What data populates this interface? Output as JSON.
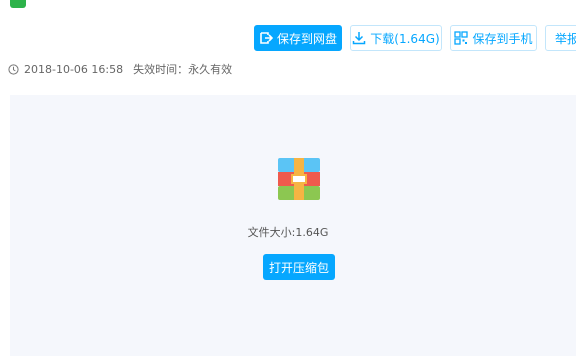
{
  "actions": {
    "save_to_cloud": "保存到网盘",
    "download": "下载(1.64G)",
    "save_to_phone": "保存到手机",
    "report": "举报"
  },
  "meta": {
    "date": "2018-10-06 16:58",
    "expire": "失效时间：永久有效"
  },
  "preview": {
    "file_size": "文件大小:1.64G",
    "open_button": "打开压缩包"
  },
  "colors": {
    "accent": "#06a7ff",
    "preview_bg": "#f5f7fc"
  }
}
